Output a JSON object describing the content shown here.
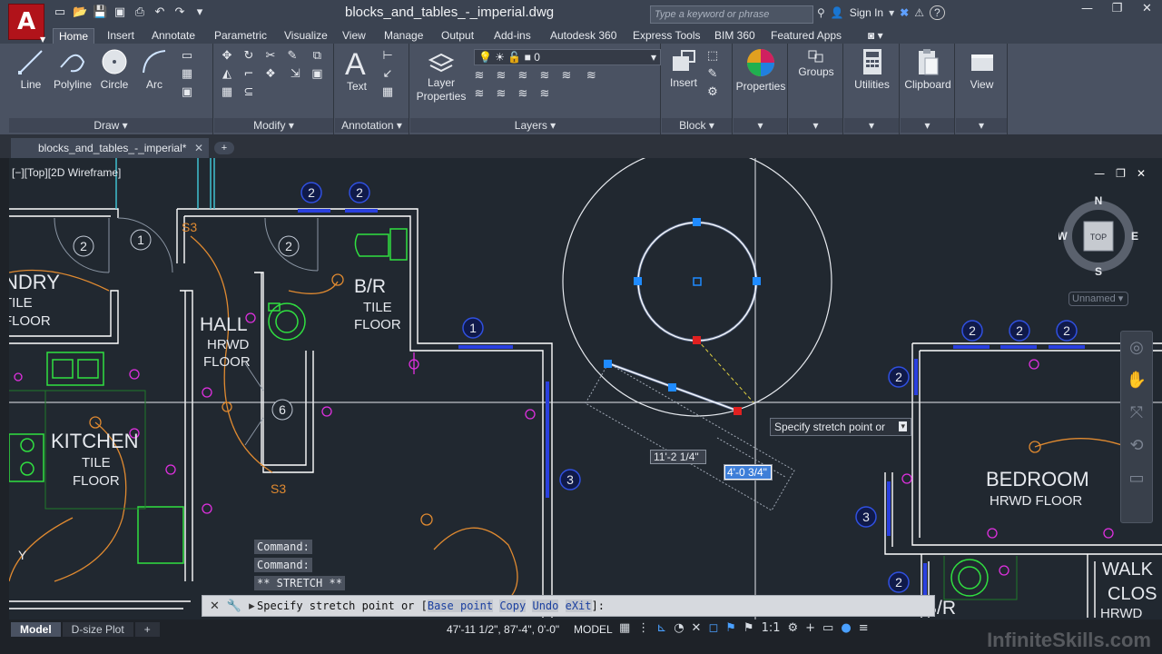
{
  "app": {
    "document_title": "blocks_and_tables_-_imperial.dwg",
    "search_placeholder": "Type a keyword or phrase",
    "sign_in": "Sign In",
    "help": "?"
  },
  "ribbon_tabs": [
    "Home",
    "Insert",
    "Annotate",
    "Parametric",
    "Visualize",
    "View",
    "Manage",
    "Output",
    "Add-ins",
    "Autodesk 360",
    "Express Tools",
    "BIM 360",
    "Featured Apps"
  ],
  "panels": {
    "draw": {
      "title": "Draw",
      "tools": [
        "Line",
        "Polyline",
        "Circle",
        "Arc"
      ]
    },
    "modify": {
      "title": "Modify"
    },
    "annotation": {
      "title": "Annotation",
      "tool": "Text"
    },
    "layers": {
      "title": "Layers",
      "tool_line1": "Layer",
      "tool_line2": "Properties",
      "current_layer": "0"
    },
    "block": {
      "title": "Block",
      "tool": "Insert"
    },
    "properties": {
      "tool": "Properties"
    },
    "groups": {
      "tool": "Groups"
    },
    "utilities": {
      "tool": "Utilities"
    },
    "clipboard": {
      "tool": "Clipboard"
    },
    "view": {
      "tool": "View"
    }
  },
  "file_tab": {
    "label": "blocks_and_tables_-_imperial*"
  },
  "viewport": {
    "label": "[−][Top][2D Wireframe]",
    "viewcube_top": "TOP",
    "compass": {
      "n": "N",
      "s": "S",
      "e": "E",
      "w": "W"
    },
    "ucs_name": "Unnamed"
  },
  "drawing": {
    "rooms": [
      {
        "name": "NDRY",
        "sub1": "TILE",
        "sub2": "FLOOR"
      },
      {
        "name": "HALL",
        "sub1": "HRWD",
        "sub2": "FLOOR"
      },
      {
        "name": "B/R",
        "sub1": "TILE",
        "sub2": "FLOOR"
      },
      {
        "name": "KITCHEN",
        "sub1": "TILE",
        "sub2": "FLOOR"
      },
      {
        "name": "BEDROOM",
        "sub1": "HRWD  FLOOR"
      },
      {
        "name": "WALK",
        "sub1": "CLOS",
        "sub2": "HRWD"
      },
      {
        "name": "B/R"
      }
    ],
    "tags": [
      "2",
      "2",
      "2",
      "1",
      "2",
      "2",
      "2",
      "2",
      "2",
      "1",
      "6",
      "3",
      "2",
      "3",
      "2",
      "3"
    ],
    "switch_label": "S3"
  },
  "stretch": {
    "tooltip": "Specify stretch point or",
    "dim1": "11'-2 1/4\"",
    "dim2": "4'-0 3/4\""
  },
  "command": {
    "history": [
      "Command:",
      "Command:",
      "** STRETCH **"
    ],
    "prompt_prefix": "Specify stretch point or [",
    "opt1": "Base point",
    "opt2": "Copy",
    "opt3": "Undo",
    "opt4": "eXit",
    "prompt_suffix": "]:"
  },
  "status": {
    "layout_tabs": [
      "Model",
      "D-size Plot"
    ],
    "coordinates": "47'-11 1/2\", 87'-4\", 0'-0\"",
    "space": "MODEL",
    "scale": "1:1"
  },
  "watermark": "InfiniteSkills.com",
  "colors": {
    "accent": "#b1131a",
    "ribbon": "#4a5262",
    "canvas": "#212830",
    "grip": "#1f8bff",
    "hot_grip": "#e02020"
  }
}
